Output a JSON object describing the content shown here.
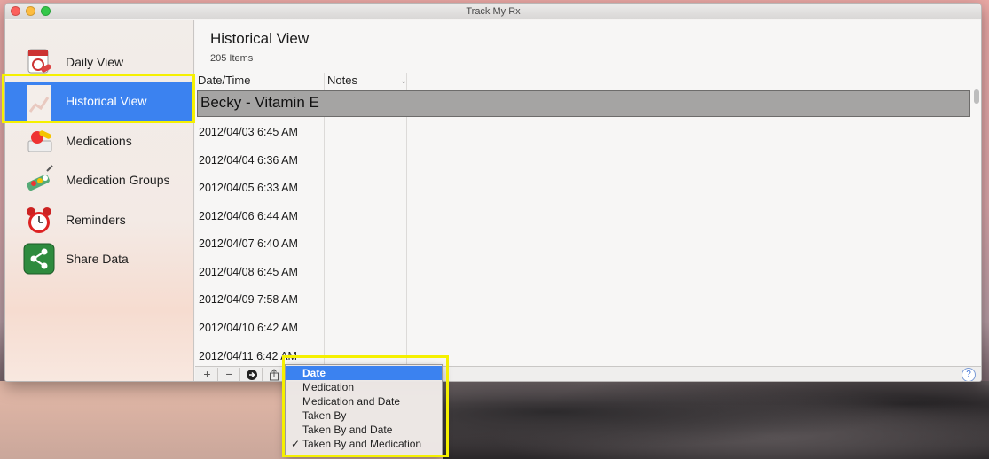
{
  "window": {
    "title": "Track My Rx"
  },
  "sidebar": {
    "items": [
      {
        "label": "Daily View",
        "icon": "calendar-pill-icon"
      },
      {
        "label": "Historical View",
        "icon": "history-notebook-icon",
        "selected": true
      },
      {
        "label": "Medications",
        "icon": "pills-icon"
      },
      {
        "label": "Medication Groups",
        "icon": "pill-groups-icon"
      },
      {
        "label": "Reminders",
        "icon": "alarm-clock-icon"
      },
      {
        "label": "Share Data",
        "icon": "share-icon"
      }
    ]
  },
  "main": {
    "title": "Historical View",
    "count": "205 Items",
    "columns": {
      "date": "Date/Time",
      "notes": "Notes"
    },
    "selected_row": "Becky - Vitamin E",
    "rows": [
      "2012/04/03 6:45 AM",
      "2012/04/04 6:36 AM",
      "2012/04/05 6:33 AM",
      "2012/04/06 6:44 AM",
      "2012/04/07 6:40 AM",
      "2012/04/08 6:45 AM",
      "2012/04/09 7:58 AM",
      "2012/04/10 6:42 AM",
      "2012/04/11 6:42 AM"
    ]
  },
  "toolbar": {
    "add": "+",
    "remove": "−",
    "go": "➜",
    "share": "⇪",
    "help": "?"
  },
  "sort_menu": {
    "items": [
      {
        "label": "Date",
        "active": true
      },
      {
        "label": "Medication"
      },
      {
        "label": "Medication and Date"
      },
      {
        "label": "Taken By"
      },
      {
        "label": "Taken By and Date"
      },
      {
        "label": "Taken By and Medication",
        "checked": true
      }
    ],
    "check_glyph": "✓"
  },
  "colors": {
    "accent": "#3b82f0",
    "annotation": "#f5f000"
  }
}
